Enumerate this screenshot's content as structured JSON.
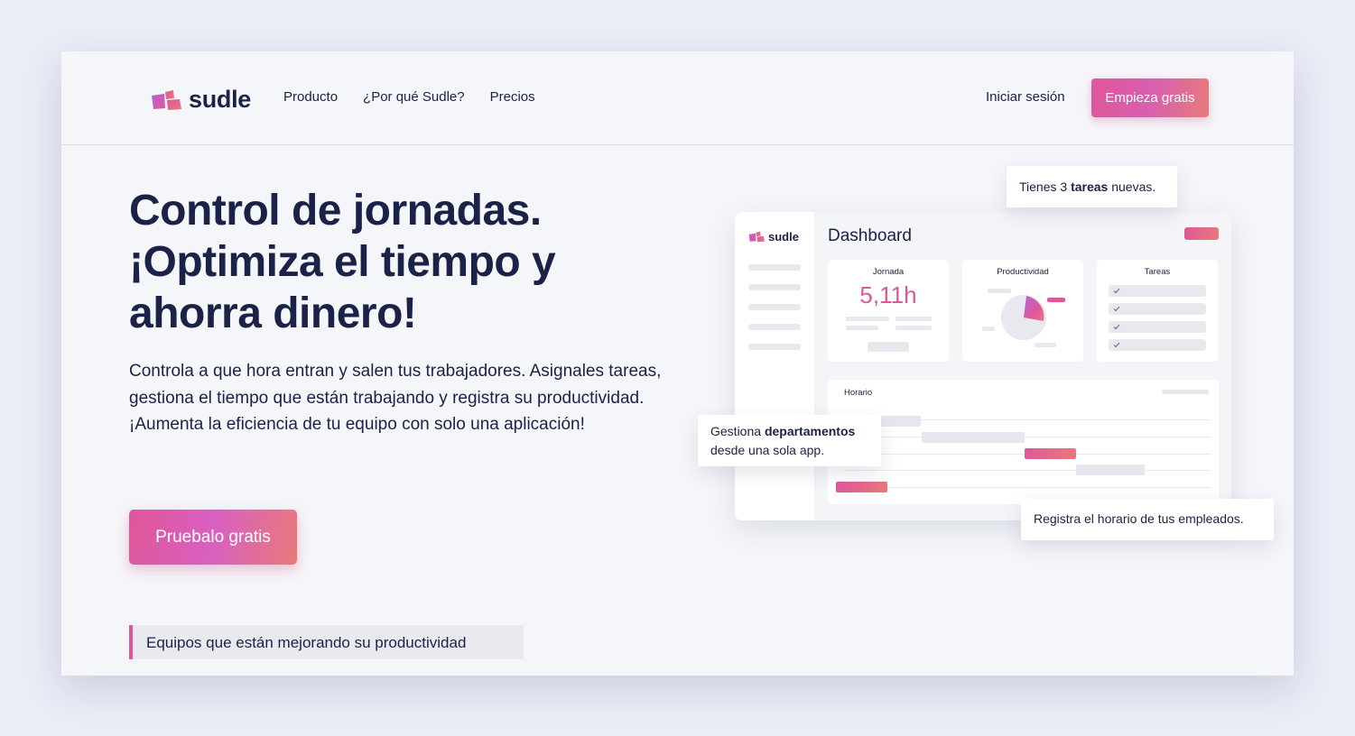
{
  "header": {
    "brand": "sudle",
    "nav": [
      "Producto",
      "¿Por qué Sudle?",
      "Precios"
    ],
    "login": "Iniciar sesión",
    "cta": "Empieza gratis"
  },
  "hero": {
    "title_lines": [
      "Control de jornadas.",
      "¡Optimiza el tiempo y",
      "ahorra dinero!"
    ],
    "description": "Controla a que hora entran y salen tus trabajadores. Asignales tareas, gestiona el tiempo que están trabajando y registra su productividad. ¡Aumenta la eficiencia de tu equipo con solo una aplicación!",
    "cta": "Pruebalo gratis",
    "teams_label": "Equipos que están mejorando su productividad"
  },
  "dashboard": {
    "brand": "sudle",
    "title": "Dashboard",
    "cards": {
      "jornada_label": "Jornada",
      "jornada_value": "5,11h",
      "productividad_label": "Productividad",
      "tareas_label": "Tareas"
    },
    "schedule_label": "Horario"
  },
  "notes": {
    "tasks_prefix": "Tienes 3 ",
    "tasks_bold": "tareas",
    "tasks_suffix": " nuevas.",
    "dept_prefix": "Gestiona ",
    "dept_bold": "departamentos",
    "dept_line2": "desde una sola app.",
    "schedule": "Registra el horario de tus empleados."
  },
  "colors": {
    "accent_pink": "#e0569a",
    "accent_coral": "#e87a7a",
    "text_dark": "#1b2247",
    "background": "#f5f6fa"
  }
}
